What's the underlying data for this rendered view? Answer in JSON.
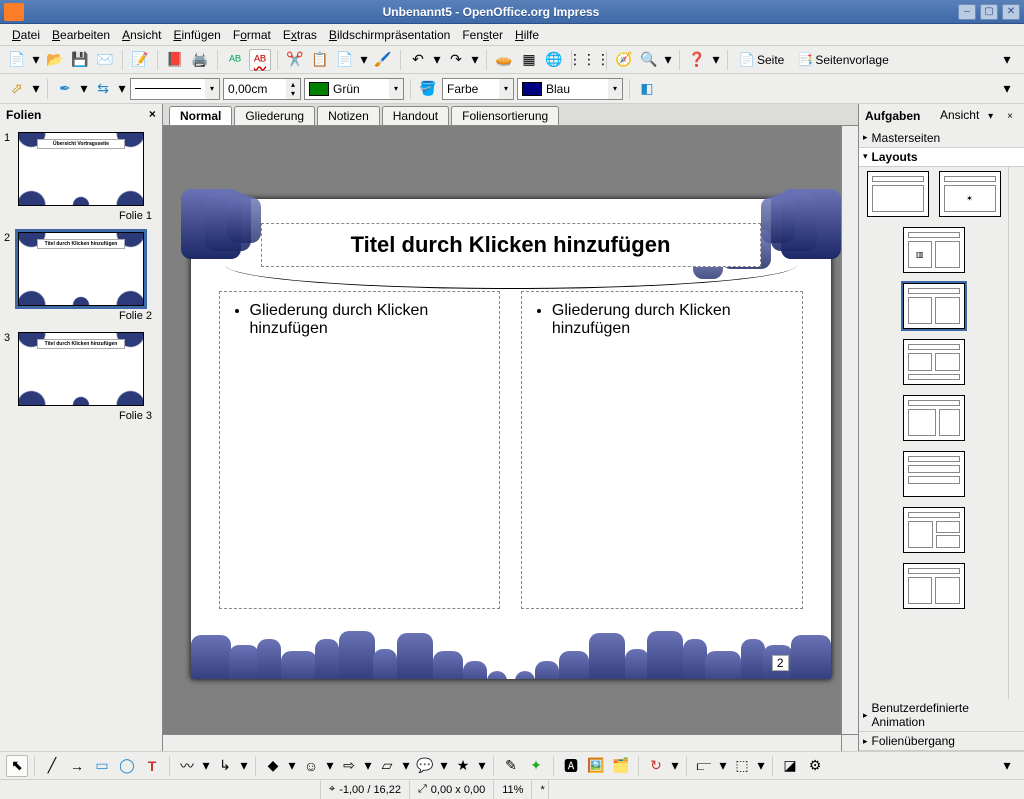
{
  "window": {
    "title": "Unbenannt5 - OpenOffice.org Impress"
  },
  "menu": [
    "Datei",
    "Bearbeiten",
    "Ansicht",
    "Einfügen",
    "Format",
    "Extras",
    "Bildschirmpräsentation",
    "Fenster",
    "Hilfe"
  ],
  "toolbar2": {
    "width_value": "0,00cm",
    "color1_name": "Grün",
    "color1_hex": "#008000",
    "mid_label": "Farbe",
    "color2_name": "Blau",
    "color2_hex": "#000080"
  },
  "page_buttons": {
    "page": "Seite",
    "template": "Seitenvorlage"
  },
  "slides_panel": {
    "title": "Folien",
    "slides": [
      {
        "num": "1",
        "caption": "Folie 1",
        "title": "Übersicht Vortragsseite"
      },
      {
        "num": "2",
        "caption": "Folie 2",
        "title": "Titel durch Klicken hinzufügen"
      },
      {
        "num": "3",
        "caption": "Folie 3",
        "title": "Titel durch Klicken hinzufügen"
      }
    ]
  },
  "view_tabs": [
    "Normal",
    "Gliederung",
    "Notizen",
    "Handout",
    "Foliensortierung"
  ],
  "slide": {
    "title_placeholder": "Titel durch Klicken hinzufügen",
    "outline_placeholder": "Gliederung durch Klicken hinzufügen",
    "page_number": "2"
  },
  "tasks_panel": {
    "title": "Aufgaben",
    "view_label": "Ansicht",
    "sections": {
      "master": "Masterseiten",
      "layouts": "Layouts",
      "custom_anim": "Benutzerdefinierte Animation",
      "transition": "Folienübergang"
    }
  },
  "statusbar": {
    "coords": "-1,00 / 16,22",
    "size": "0,00 x 0,00",
    "zoom": "11%"
  }
}
